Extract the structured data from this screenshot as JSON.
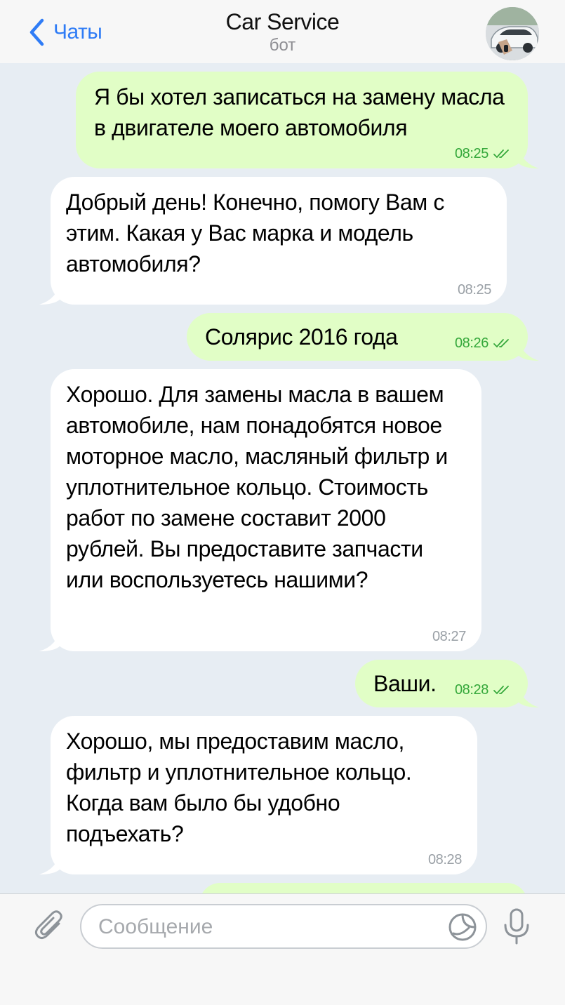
{
  "header": {
    "back_label": "Чаты",
    "title": "Car Service",
    "subtitle": "бот"
  },
  "messages": [
    {
      "direction": "out",
      "text": "Я бы хотел записаться на замену масла в двигателе моего автомобиля",
      "time": "08:25",
      "status": "read"
    },
    {
      "direction": "in",
      "text": "Добрый день! Конечно, помогу Вам с этим. Какая у Вас марка и модель автомобиля?",
      "time": "08:25"
    },
    {
      "direction": "out",
      "text": "Солярис 2016 года",
      "time": "08:26",
      "status": "read"
    },
    {
      "direction": "in",
      "text": "Хорошо. Для замены масла в вашем автомобиле, нам понадобятся новое моторное масло, масляный фильтр и уплотнительное кольцо. Стоимость работ по замене составит 2000 рублей. Вы предоставите запчасти или воспользуетесь нашими?",
      "time": "08:27"
    },
    {
      "direction": "out",
      "text": "Ваши.",
      "time": "08:28",
      "status": "read"
    },
    {
      "direction": "in",
      "text": "Хорошо, мы предоставим масло, фильтр и уплотнительное кольцо. Когда вам было бы удобно подъехать?",
      "time": "08:28"
    }
  ],
  "composer": {
    "placeholder": "Сообщение"
  },
  "icons": {
    "back": "chevron-left-icon",
    "attach": "paperclip-icon",
    "sticker": "sticker-icon",
    "mic": "microphone-icon",
    "read": "double-check-icon"
  },
  "colors": {
    "accent": "#2f7cf6",
    "outgoing_bubble": "#e1fec6",
    "incoming_bubble": "#ffffff",
    "chat_background": "#e7edf3",
    "read_check": "#35a83b"
  }
}
